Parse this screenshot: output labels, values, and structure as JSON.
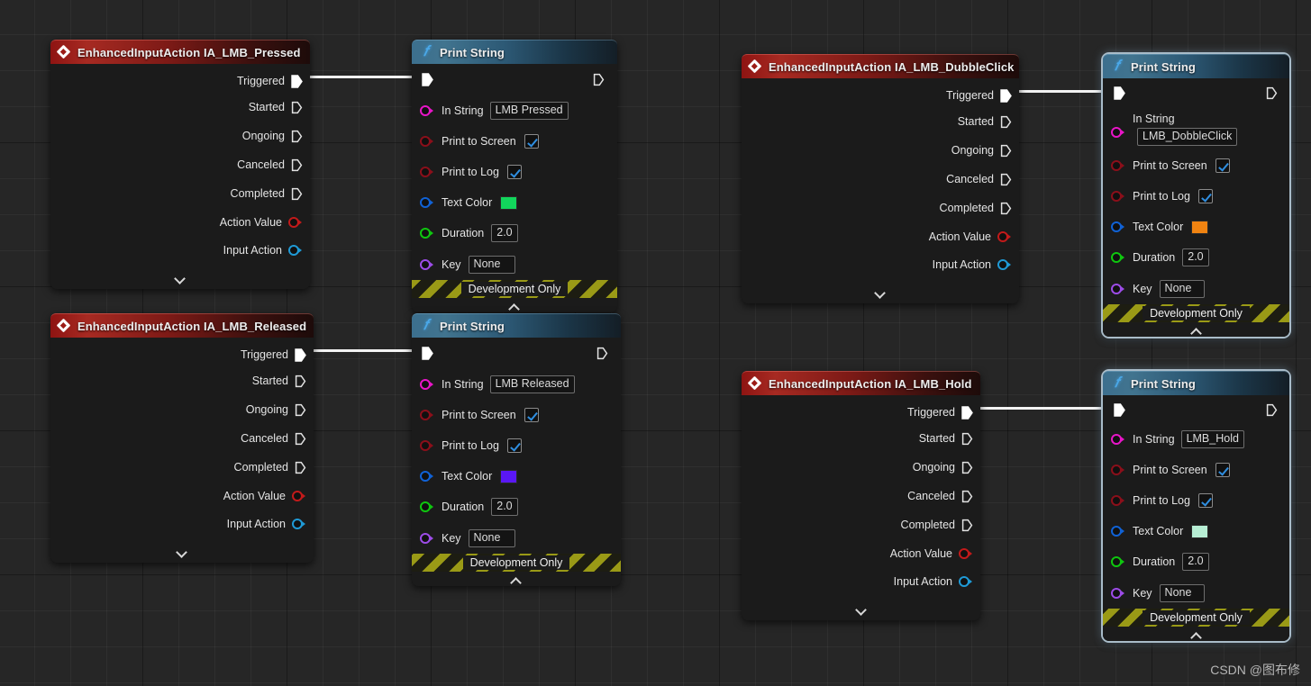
{
  "canvas": {
    "watermark": "CSDN @图布修",
    "grid_color": "#262626"
  },
  "wires": [
    {
      "name": "wire-pressed-to-print"
    },
    {
      "name": "wire-released-to-print"
    },
    {
      "name": "wire-dubbleclick-to-print"
    },
    {
      "name": "wire-hold-to-print"
    }
  ],
  "event_nodes": [
    {
      "id": "ia-lmb-pressed",
      "title": "EnhancedInputAction IA_LMB_Pressed",
      "exec_outputs": [
        "Triggered",
        "Started",
        "Ongoing",
        "Canceled",
        "Completed"
      ],
      "data_outputs": [
        {
          "label": "Action Value",
          "color": "#c21a1a"
        },
        {
          "label": "Input Action",
          "color": "#1f9ad6"
        }
      ]
    },
    {
      "id": "ia-lmb-released",
      "title": "EnhancedInputAction IA_LMB_Released",
      "exec_outputs": [
        "Triggered",
        "Started",
        "Ongoing",
        "Canceled",
        "Completed"
      ],
      "data_outputs": [
        {
          "label": "Action Value",
          "color": "#c21a1a"
        },
        {
          "label": "Input Action",
          "color": "#1f9ad6"
        }
      ]
    },
    {
      "id": "ia-lmb-dubbleclick",
      "title": "EnhancedInputAction IA_LMB_DubbleClick",
      "exec_outputs": [
        "Triggered",
        "Started",
        "Ongoing",
        "Canceled",
        "Completed"
      ],
      "data_outputs": [
        {
          "label": "Action Value",
          "color": "#c21a1a"
        },
        {
          "label": "Input Action",
          "color": "#1f9ad6"
        }
      ]
    },
    {
      "id": "ia-lmb-hold",
      "title": "EnhancedInputAction IA_LMB_Hold",
      "exec_outputs": [
        "Triggered",
        "Started",
        "Ongoing",
        "Canceled",
        "Completed"
      ],
      "data_outputs": [
        {
          "label": "Action Value",
          "color": "#c21a1a"
        },
        {
          "label": "Input Action",
          "color": "#1f9ad6"
        }
      ]
    }
  ],
  "print_nodes": [
    {
      "id": "print-string-pressed",
      "title": "Print String",
      "in_string_label": "In String",
      "in_string_value": "LMB Pressed",
      "print_to_screen_label": "Print to Screen",
      "print_to_screen_checked": true,
      "print_to_log_label": "Print to Log",
      "print_to_log_checked": true,
      "text_color_label": "Text Color",
      "text_color_value": "#12d65c",
      "duration_label": "Duration",
      "duration_value": "2.0",
      "key_label": "Key",
      "key_value": "None",
      "footer": "Development Only"
    },
    {
      "id": "print-string-released",
      "title": "Print String",
      "in_string_label": "In String",
      "in_string_value": "LMB Released",
      "print_to_screen_label": "Print to Screen",
      "print_to_screen_checked": true,
      "print_to_log_label": "Print to Log",
      "print_to_log_checked": true,
      "text_color_label": "Text Color",
      "text_color_value": "#5a17f5",
      "duration_label": "Duration",
      "duration_value": "2.0",
      "key_label": "Key",
      "key_value": "None",
      "footer": "Development Only"
    },
    {
      "id": "print-string-dubbleclick",
      "title": "Print String",
      "in_string_label": "In String",
      "in_string_value": "LMB_DobbleClick",
      "print_to_screen_label": "Print to Screen",
      "print_to_screen_checked": true,
      "print_to_log_label": "Print to Log",
      "print_to_log_checked": true,
      "text_color_label": "Text Color",
      "text_color_value": "#f08311",
      "duration_label": "Duration",
      "duration_value": "2.0",
      "key_label": "Key",
      "key_value": "None",
      "footer": "Development Only"
    },
    {
      "id": "print-string-hold",
      "title": "Print String",
      "in_string_label": "In String",
      "in_string_value": "LMB_Hold",
      "print_to_screen_label": "Print to Screen",
      "print_to_screen_checked": true,
      "print_to_log_label": "Print to Log",
      "print_to_log_checked": true,
      "text_color_label": "Text Color",
      "text_color_value": "#b7eed4",
      "duration_label": "Duration",
      "duration_value": "2.0",
      "key_label": "Key",
      "key_value": "None",
      "footer": "Development Only"
    }
  ],
  "pin_colors": {
    "string": "#e915c8",
    "boolean": "#8b0f1a",
    "linear_color": "#1062d6",
    "float": "#0fc70f",
    "name": "#9d4ce8"
  }
}
